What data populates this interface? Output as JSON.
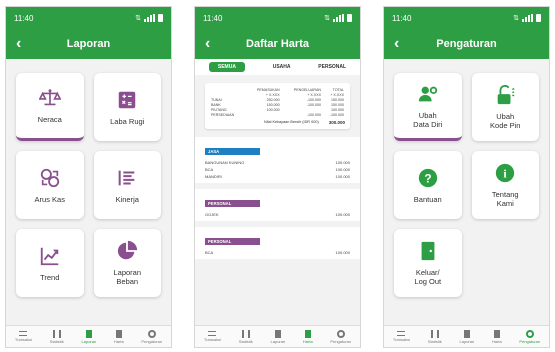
{
  "status": {
    "time": "11:40"
  },
  "colors": {
    "primary": "#2e9e45",
    "accent_purple": "#8a4f8f",
    "accent_blue": "#1e7fc2"
  },
  "laporan": {
    "title": "Laporan",
    "cards": [
      {
        "label": "Neraca",
        "icon": "scale-icon"
      },
      {
        "label": "Laba Rugi",
        "icon": "calculator-icon"
      },
      {
        "label": "Arus Kas",
        "icon": "cash-flow-icon"
      },
      {
        "label": "Kinerja",
        "icon": "list-icon"
      },
      {
        "label": "Trend",
        "icon": "trend-chart-icon"
      },
      {
        "label": "Laporan\nBeban",
        "icon": "pie-chart-icon"
      }
    ]
  },
  "harta": {
    "title": "Daftar Harta",
    "tabs": [
      "SEMUA",
      "USAHA",
      "PERSONAL"
    ],
    "summary": {
      "headers": [
        "",
        "PEMASUKAN",
        "PENGELUARAN",
        "TOTAL"
      ],
      "subheaders": [
        "",
        "+ X.XXX",
        "+ X.XXX",
        "+ X.XXX"
      ],
      "rows": [
        [
          "TUNAI",
          "250.000",
          "-100.000",
          "150.000"
        ],
        [
          "BANK",
          "150.000",
          "-100.000",
          "150.000"
        ],
        [
          "PIUTANG",
          "100.000",
          "",
          "100.000"
        ],
        [
          "PERSEDIAAN",
          "",
          "-100.000",
          "-100.000"
        ]
      ],
      "total_label": "Nilai Kekayaan Bersih (IDR 000)",
      "total_value": "300.000"
    },
    "sections": [
      {
        "tag": "JASA",
        "rows": [
          [
            "BANGUNAN KUNING",
            "100.000"
          ],
          [
            "BCA",
            "100.000"
          ],
          [
            "MANDIRI",
            "100.000"
          ]
        ]
      },
      {
        "tag": "PERSONAL",
        "rows": [
          [
            "GOJEK",
            "100.000"
          ]
        ]
      },
      {
        "tag": "PERSONAL",
        "rows": [
          [
            "BCA",
            "100.000"
          ]
        ]
      }
    ]
  },
  "pengaturan": {
    "title": "Pengaturan",
    "cards": [
      {
        "label": "Ubah\nData Diri",
        "icon": "user-settings-icon"
      },
      {
        "label": "Ubah\nKode Pin",
        "icon": "lock-icon"
      },
      {
        "label": "Bantuan",
        "icon": "help-icon"
      },
      {
        "label": "Tentang\nKami",
        "icon": "info-icon"
      },
      {
        "label": "Keluar/\nLog Out",
        "icon": "logout-icon"
      }
    ]
  },
  "nav": [
    "Transaksi",
    "Statistik",
    "Laporan",
    "Harta",
    "Pengaturan"
  ]
}
